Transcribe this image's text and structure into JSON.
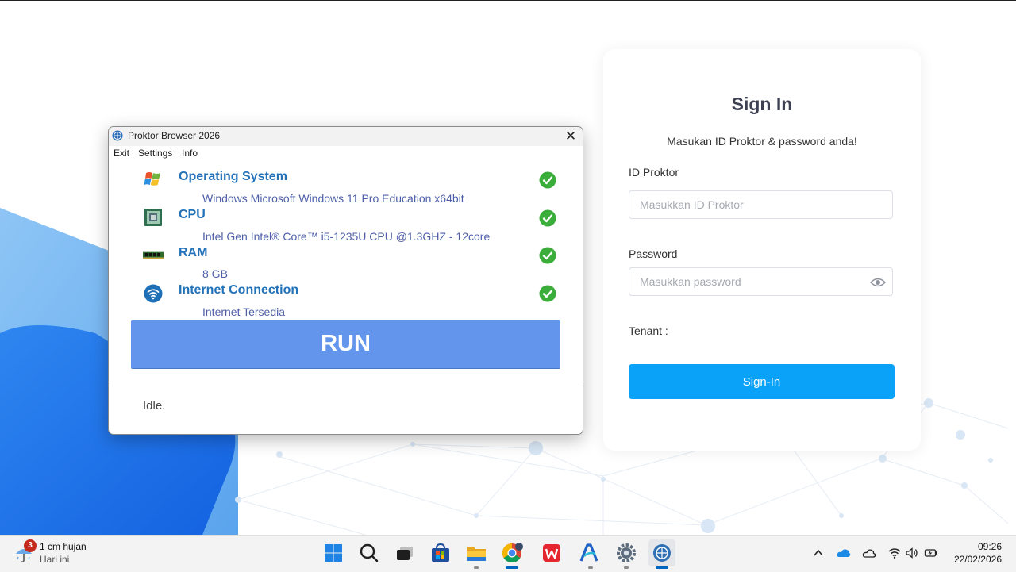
{
  "signin": {
    "title": "Sign In",
    "subtitle": "Masukan ID Proktor & password anda!",
    "id_label": "ID Proktor",
    "id_placeholder": "Masukkan ID Proktor",
    "id_value": "",
    "password_label": "Password",
    "password_placeholder": "Masukkan password",
    "password_value": "",
    "tenant_label": "Tenant :",
    "button_label": "Sign-In",
    "accent_color": "#0aa2f8"
  },
  "proktor": {
    "title": "Proktor Browser 2026",
    "menu": [
      "Exit",
      "Settings",
      "Info"
    ],
    "specs": [
      {
        "icon": "windows-logo-icon",
        "title": "Operating System",
        "value": "Windows Microsoft Windows 11 Pro Education x64bit",
        "status": "ok"
      },
      {
        "icon": "cpu-chip-icon",
        "title": "CPU",
        "value": "Intel Gen Intel® Core™ i5-1235U CPU @1.3GHZ - 12core",
        "status": "ok"
      },
      {
        "icon": "ram-module-icon",
        "title": "RAM",
        "value": "8 GB",
        "status": "ok"
      },
      {
        "icon": "wifi-icon",
        "title": "Internet Connection",
        "value": "Internet Tersedia",
        "status": "ok"
      }
    ],
    "run_label": "RUN",
    "status_text": "Idle.",
    "run_color": "#6495ed",
    "check_color": "#3aad3a"
  },
  "taskbar": {
    "weather": {
      "badge": "3",
      "temp": "1 cm hujan",
      "location": "Hari ini"
    },
    "apps": [
      "start-icon",
      "search-icon",
      "task-view-icon",
      "store-icon",
      "file-explorer-icon",
      "chrome-icon",
      "wps-office-icon",
      "anthology-icon",
      "settings-icon",
      "proktor-browser-icon"
    ],
    "tray": [
      "chevron-up-icon",
      "onedrive-icon",
      "cloud-icon",
      "wifi-icon",
      "volume-icon",
      "battery-icon"
    ],
    "time": "09:26",
    "date": "22/02/2026"
  }
}
